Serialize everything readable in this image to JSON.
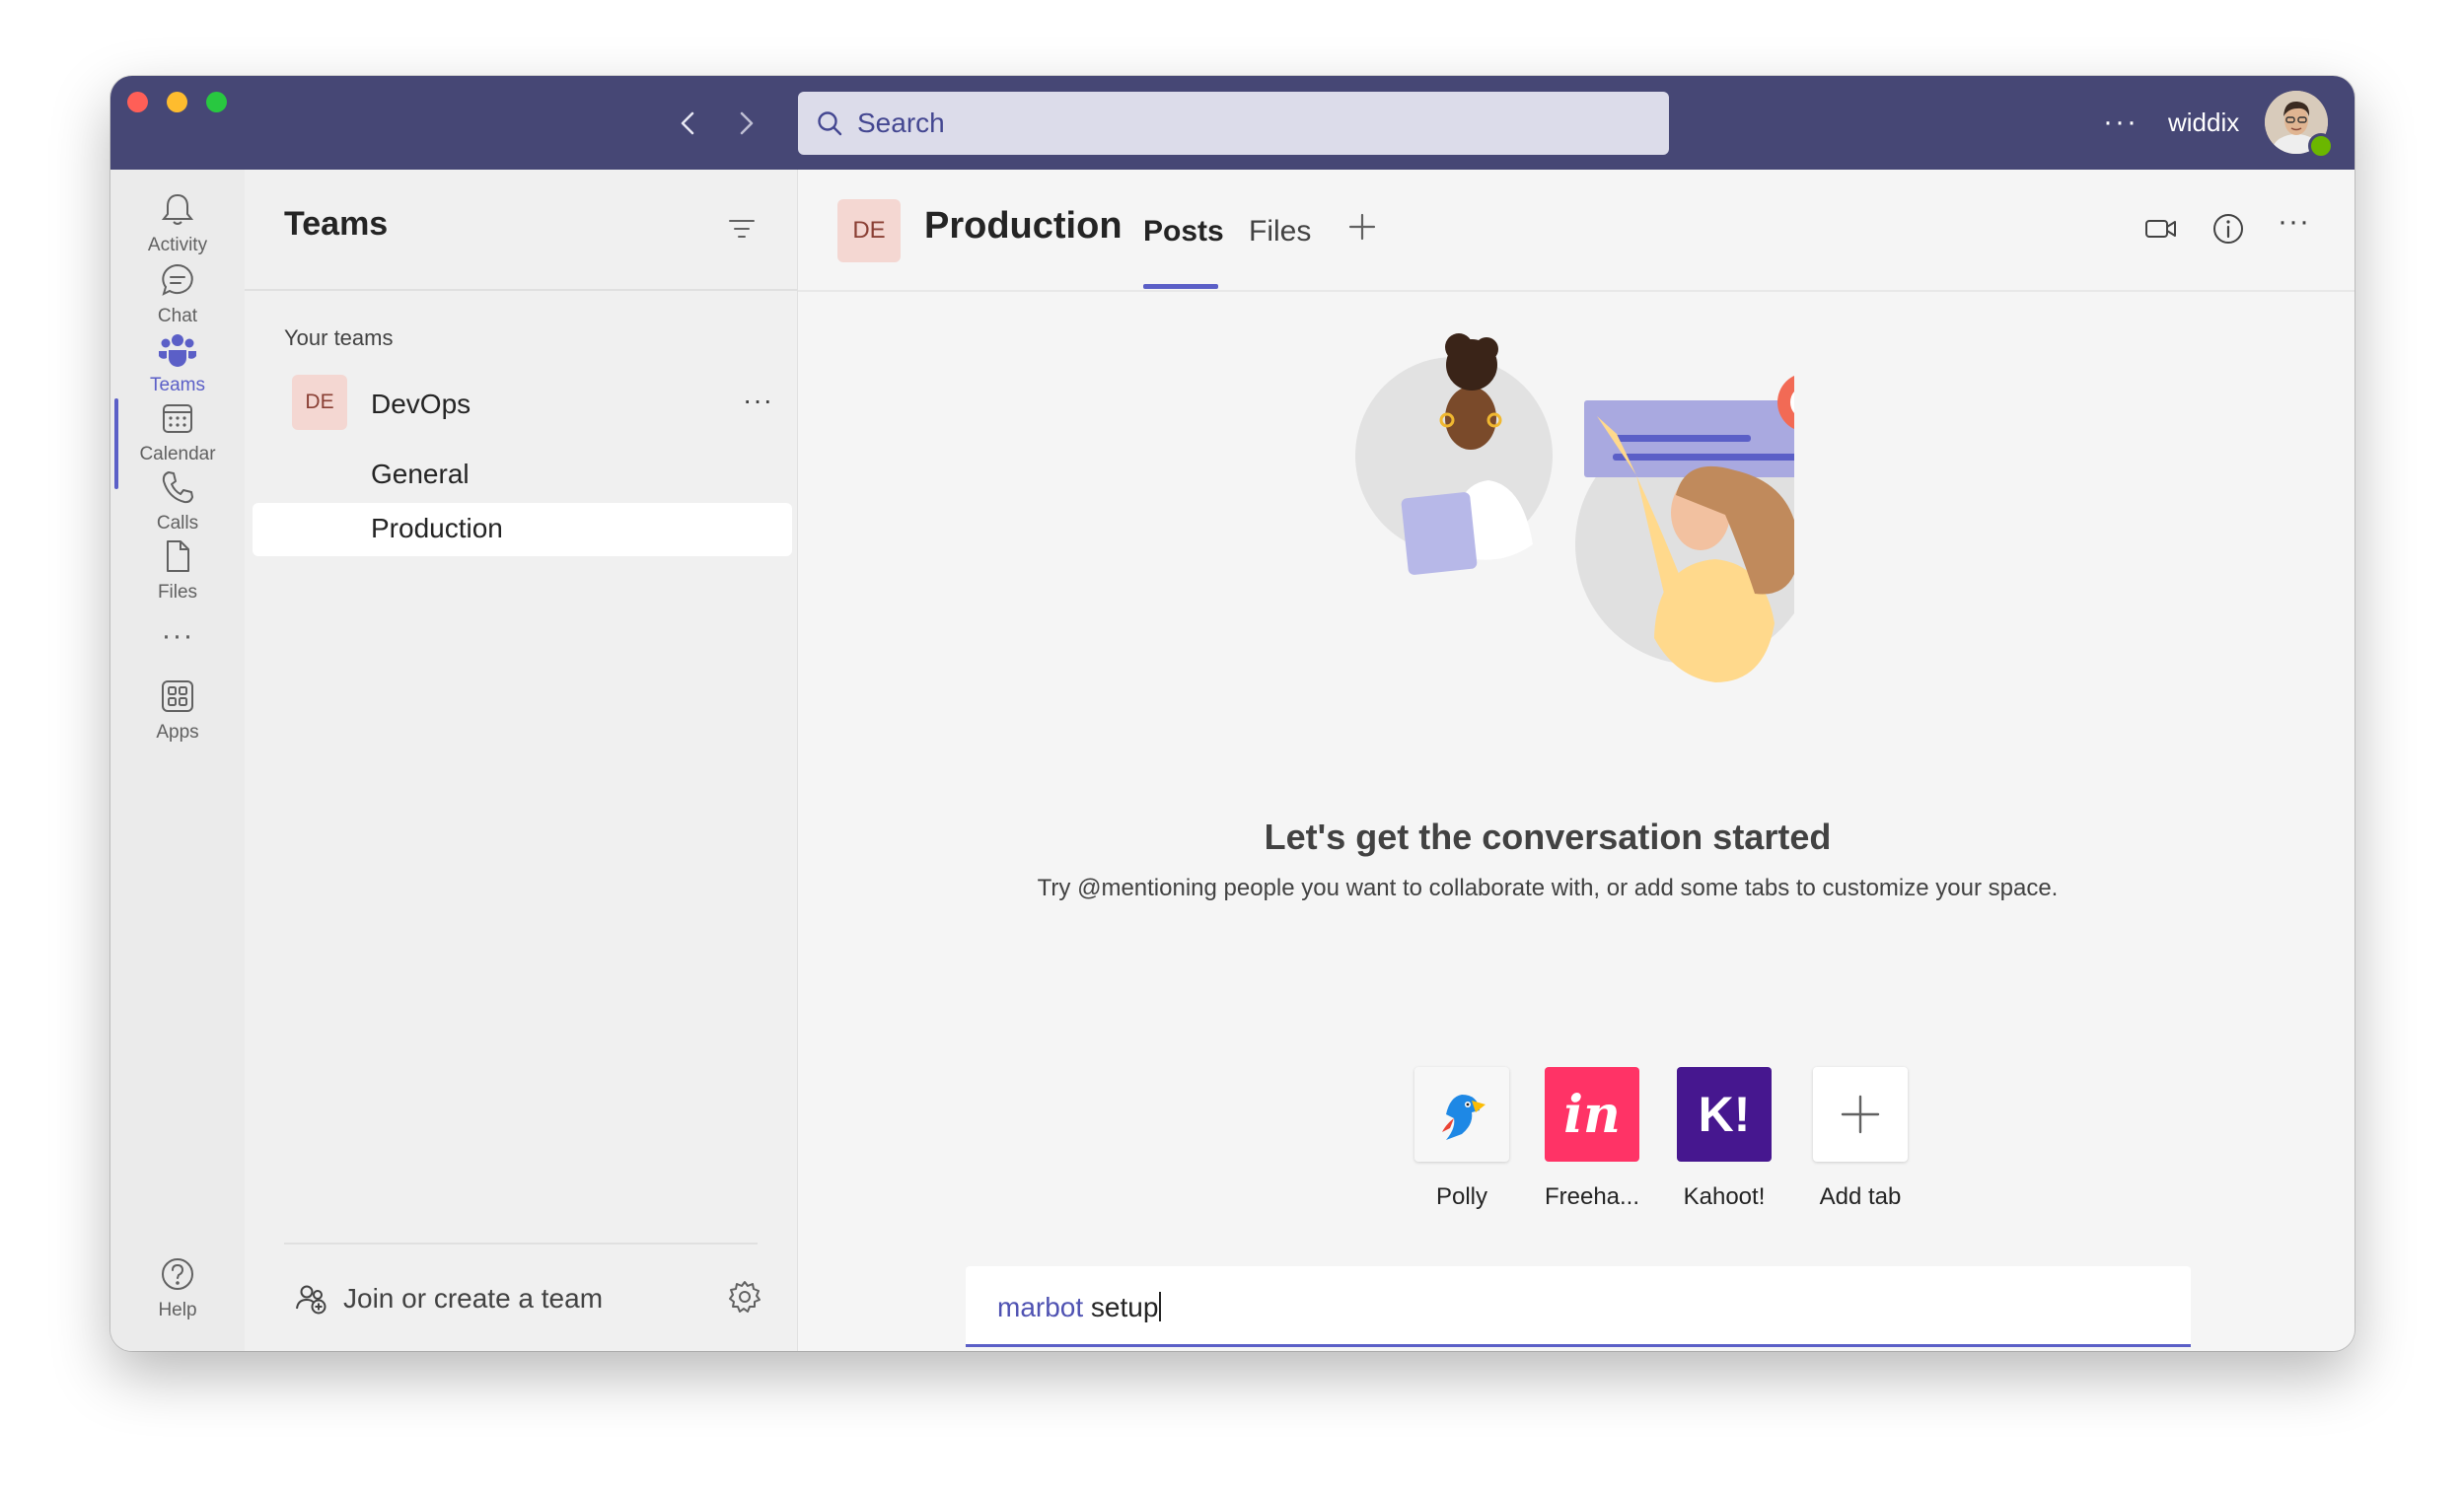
{
  "titlebar": {
    "search_placeholder": "Search",
    "more_label": "···",
    "username": "widdix"
  },
  "rail": {
    "items": [
      {
        "label": "Activity",
        "icon": "bell-icon"
      },
      {
        "label": "Chat",
        "icon": "chat-icon"
      },
      {
        "label": "Teams",
        "icon": "teams-icon",
        "active": true
      },
      {
        "label": "Calendar",
        "icon": "calendar-icon"
      },
      {
        "label": "Calls",
        "icon": "phone-icon"
      },
      {
        "label": "Files",
        "icon": "file-icon"
      }
    ],
    "more_label": "···",
    "apps_label": "Apps",
    "help_label": "Help"
  },
  "teams_pane": {
    "title": "Teams",
    "section_label": "Your teams",
    "team": {
      "avatar_initials": "DE",
      "name": "DevOps",
      "more_label": "···",
      "channels": [
        "General",
        "Production"
      ]
    },
    "join_label": "Join or create a team"
  },
  "channel": {
    "avatar_initials": "DE",
    "title": "Production",
    "tabs": [
      "Posts",
      "Files"
    ],
    "active_tab": "Posts",
    "more_label": "···"
  },
  "empty_state": {
    "title": "Let's get the conversation started",
    "subtitle": "Try @mentioning people you want to collaborate with, or add some tabs to customize your space."
  },
  "apps": [
    {
      "label": "Polly",
      "glyph": ""
    },
    {
      "label": "Freeha...",
      "glyph": "in"
    },
    {
      "label": "Kahoot!",
      "glyph": "K!"
    },
    {
      "label": "Add tab",
      "glyph": "+"
    }
  ],
  "compose": {
    "mention": "marbot",
    "text": " setup"
  },
  "toolbar_more": "···",
  "colors": {
    "titlebar": "#464775",
    "accent": "#5b5fc7",
    "invision": "#ff3366",
    "kahoot": "#46178f"
  }
}
